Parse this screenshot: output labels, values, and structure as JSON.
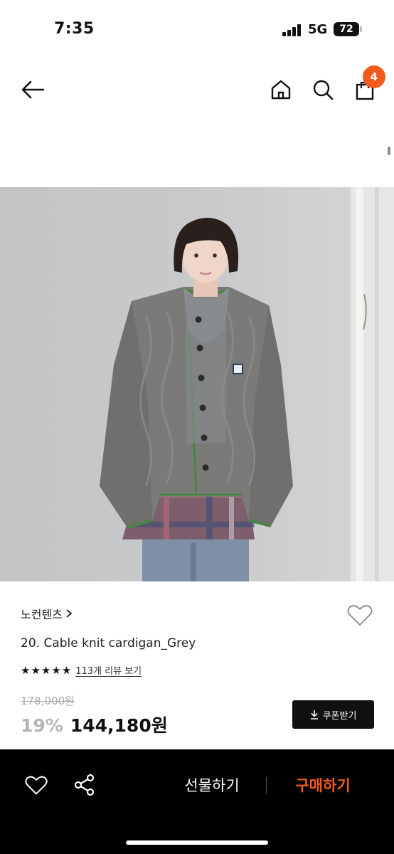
{
  "status_bar": {
    "time": "7:35",
    "network": "5G",
    "battery": "72"
  },
  "nav": {
    "cart_count": "4"
  },
  "product": {
    "brand": "노컨텐츠",
    "name": "20. Cable knit cardigan_Grey",
    "rating_stars": 5,
    "review_link": "113개 리뷰 보기",
    "original_price": "178,000원",
    "discount": "19%",
    "sale_price": "144,180원",
    "coupon_label": "쿠폰받기"
  },
  "bottom_bar": {
    "gift_label": "선물하기",
    "buy_label": "구매하기"
  },
  "colors": {
    "accent": "#f55a1c",
    "dark": "#111111"
  }
}
